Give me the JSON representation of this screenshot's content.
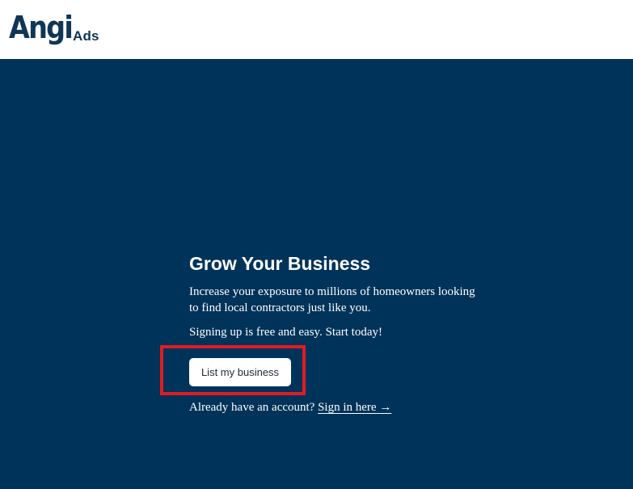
{
  "header": {
    "logo_text": "Angi",
    "logo_suffix": "Ads"
  },
  "hero": {
    "title": "Grow Your Business",
    "description": "Increase your exposure to millions of homeowners looking to find local contractors just like you.",
    "signup_text": "Signing up is free and easy. Start today!",
    "cta_label": "List my business",
    "account_prompt": "Already have an account?",
    "signin_label": "Sign in here",
    "signin_arrow": "→"
  },
  "colors": {
    "brand_navy": "#003359",
    "logo_navy": "#0f3656",
    "highlight_red": "#e11b22",
    "header_bg": "#ffffff"
  }
}
